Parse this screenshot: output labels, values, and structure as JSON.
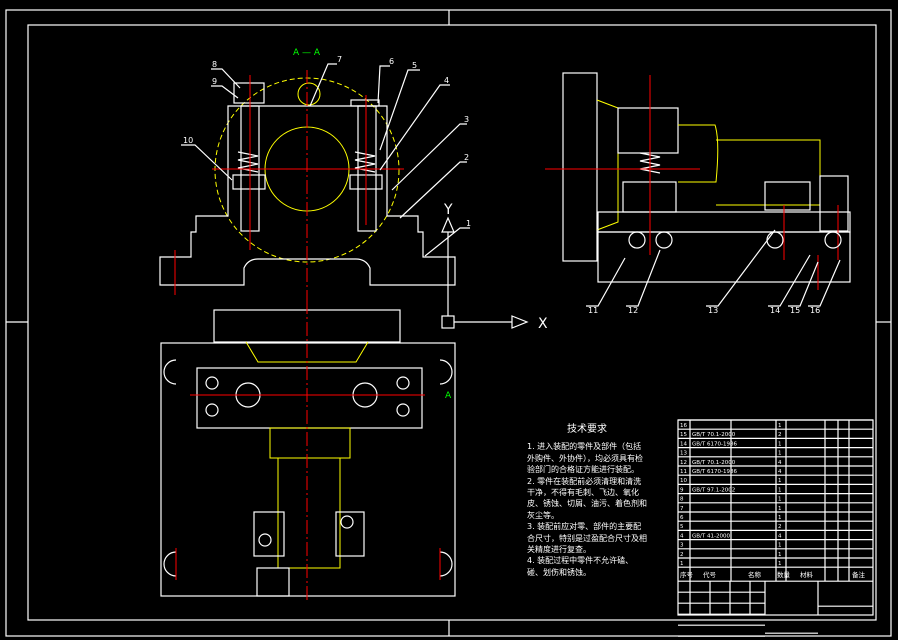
{
  "section_label": "A — A",
  "axis_labels": {
    "x": "X",
    "y": "Y"
  },
  "view_marker": "A",
  "part_numbers_front": [
    "8",
    "9",
    "7",
    "6",
    "5",
    "4",
    "3",
    "2",
    "1",
    "10"
  ],
  "part_numbers_side": [
    "11",
    "12",
    "13",
    "14",
    "15",
    "16"
  ],
  "tech_requirements": {
    "title": "技术要求",
    "items": [
      "1. 进入装配的零件及部件（包括外购件、外协件），均必须具有检验部门的合格证方能进行装配。",
      "2. 零件在装配前必须清理和清洗干净，不得有毛刺、飞边、氧化皮、锈蚀、切屑、油污、着色剂和灰尘等。",
      "3. 装配前应对零、部件的主要配合尺寸，特别是过盈配合尺寸及相关精度进行复查。",
      "4. 装配过程中零件不允许磕、碰、划伤和锈蚀。"
    ]
  },
  "bom": {
    "headers": [
      "序号",
      "代号",
      "名称",
      "数量",
      "材料",
      "备注"
    ],
    "rows": [
      {
        "no": "16",
        "code": "",
        "qty": "1"
      },
      {
        "no": "15",
        "code": "GB/T 70.1-2000",
        "qty": "2"
      },
      {
        "no": "14",
        "code": "GB/T 6170-1986",
        "qty": "1"
      },
      {
        "no": "13",
        "code": "",
        "qty": "1"
      },
      {
        "no": "12",
        "code": "GB/T 70.1-2000",
        "qty": "4"
      },
      {
        "no": "11",
        "code": "GB/T 6170-1986",
        "qty": "4"
      },
      {
        "no": "10",
        "code": "",
        "qty": "1"
      },
      {
        "no": "9",
        "code": "GB/T 97.1-2002",
        "qty": "1"
      },
      {
        "no": "8",
        "code": "",
        "qty": "1"
      },
      {
        "no": "7",
        "code": "",
        "qty": "1"
      },
      {
        "no": "6",
        "code": "",
        "qty": "1"
      },
      {
        "no": "5",
        "code": "",
        "qty": "2"
      },
      {
        "no": "4",
        "code": "GB/T 41-2000",
        "qty": "4"
      },
      {
        "no": "3",
        "code": "",
        "qty": "1"
      },
      {
        "no": "2",
        "code": "",
        "qty": "1"
      },
      {
        "no": "1",
        "code": "",
        "qty": "1"
      }
    ]
  },
  "title_block": {
    "scale": "1:1"
  },
  "colors": {
    "outline": "#ffffff",
    "hidden": "#ffff00",
    "center": "#ff0000",
    "hatch": "#00ffff",
    "label": "#00ff00"
  }
}
